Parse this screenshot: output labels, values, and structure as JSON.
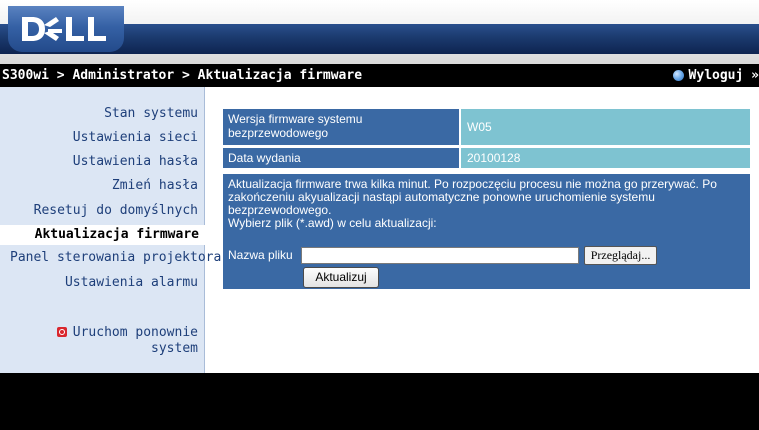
{
  "header": {
    "logo_text": "DELL"
  },
  "breadcrumb": {
    "path": "S300wi > Administrator > Aktualizacja firmware",
    "logout_label": "Wyloguj »"
  },
  "sidebar": {
    "items": [
      {
        "label": "Stan systemu"
      },
      {
        "label": "Ustawienia sieci"
      },
      {
        "label": "Ustawienia hasła"
      },
      {
        "label": "Zmień hasła"
      },
      {
        "label": "Resetuj do domyślnych"
      },
      {
        "label": "Aktualizacja firmware",
        "active": true
      },
      {
        "label": "Panel sterowania projektora"
      },
      {
        "label": "Ustawienia alarmu"
      }
    ],
    "restart_line1": "Uruchom ponownie",
    "restart_line2": "system"
  },
  "firmware": {
    "version_label_line1": "Wersja firmware systemu",
    "version_label_line2": "bezprzewodowego",
    "version_value": "W05",
    "date_label": "Data wydania",
    "date_value": "20100128",
    "info_line1": "Aktualizacja firmware trwa kilka minut. Po rozpoczęciu procesu nie można go przerywać. Po",
    "info_line2": "zakończeniu akyualizacji nastąpi automatyczne ponowne uruchomienie systemu",
    "info_line3": "bezprzewodowego.",
    "info_line4": "Wybierz plik (*.awd) w celu aktualizacji:",
    "file_label": "Nazwa pliku",
    "file_value": "",
    "browse_label": "Przeglądaj...",
    "update_label": "Aktualizuj"
  },
  "colors": {
    "label_bg": "#3a69a4",
    "value_bg": "#7ec3d1",
    "sidebar_bg": "#dce6f4",
    "sidebar_text": "#1e3f7a"
  }
}
